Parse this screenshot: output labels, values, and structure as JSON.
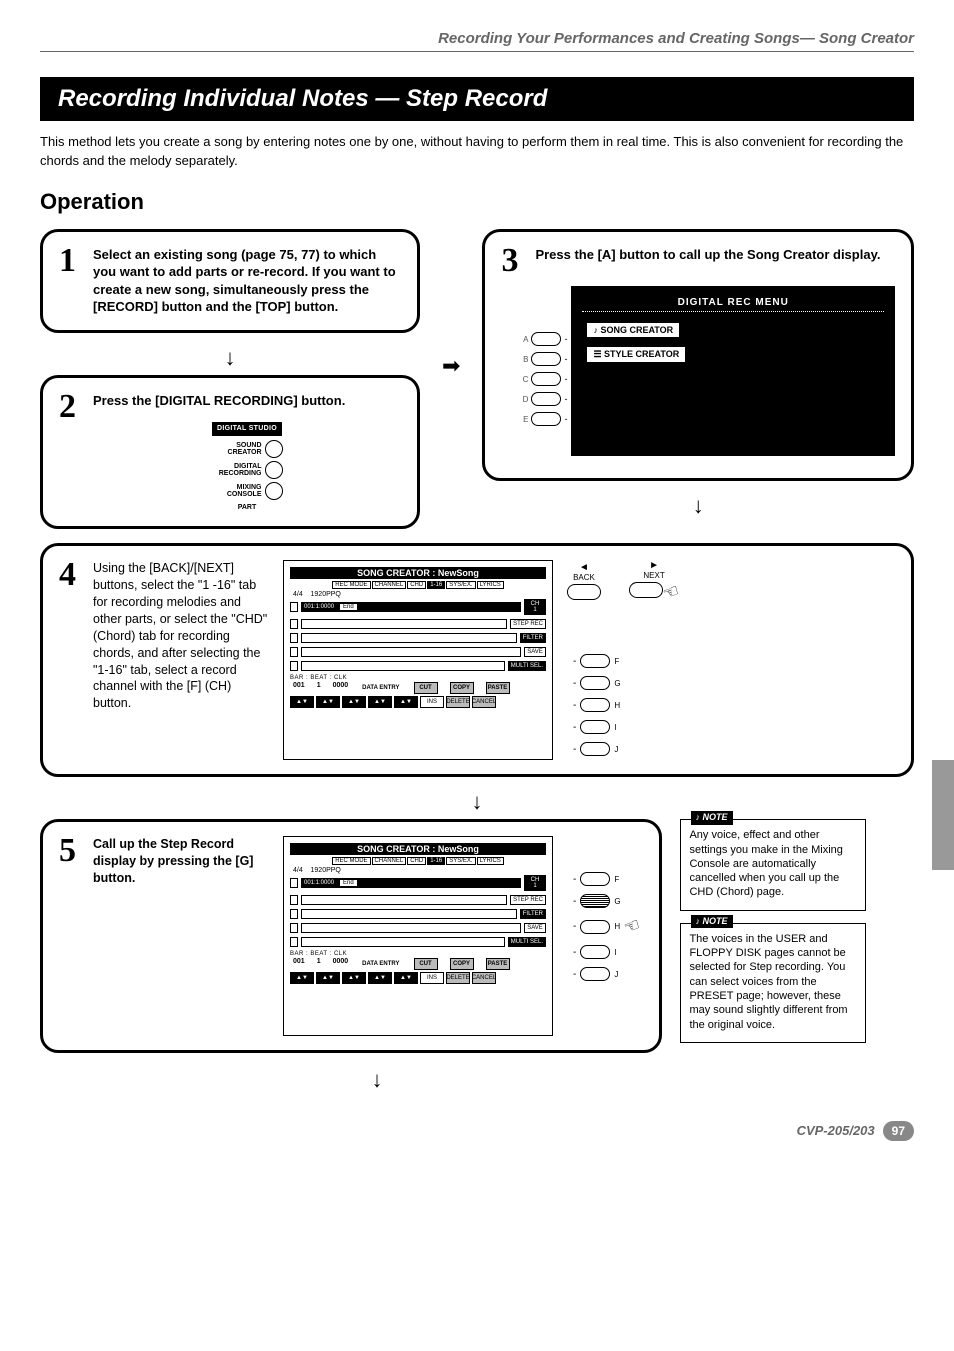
{
  "header": {
    "breadcrumb": "Recording Your Performances and Creating Songs— Song Creator"
  },
  "section": {
    "title": "Recording Individual Notes — Step Record"
  },
  "intro": "This method lets you create a song by entering notes one by one, without having to perform them in real time. This is also convenient for recording the chords and the melody separately.",
  "operation_heading": "Operation",
  "steps": {
    "s1": {
      "num": "1",
      "text": "Select an existing song (page 75, 77) to which you want to add parts or re-record. If you want to create a new song, simultaneously press the [RECORD] button and the [TOP] button."
    },
    "s2": {
      "num": "2",
      "text": "Press the [DIGITAL RECORDING] button.",
      "panel": {
        "group": "DIGITAL STUDIO",
        "btn1": "SOUND CREATOR",
        "btn2": "DIGITAL RECORDING",
        "btn3": "MIXING CONSOLE",
        "part": "PART"
      }
    },
    "s3": {
      "num": "3",
      "text": "Press the [A] button to call up the Song Creator display.",
      "lcd_title": "DIGITAL REC MENU",
      "opts": {
        "a": "SONG CREATOR",
        "b": "STYLE CREATOR"
      },
      "letters": [
        "A",
        "B",
        "C",
        "D",
        "E"
      ]
    },
    "s4": {
      "num": "4",
      "text": "Using the [BACK]/[NEXT] buttons, select the \"1 -16\" tab for recording melodies and other parts, or select the \"CHD\" (Chord) tab for recording chords, and after selecting the \"1-16\" tab, select a record channel with the [F] (CH) button.",
      "back": "BACK",
      "next": "NEXT"
    },
    "s5": {
      "num": "5",
      "text": "Call up the Step Record display by pressing the [G] button."
    }
  },
  "screen": {
    "title": "SONG CREATOR : NewSong",
    "tabs": [
      "REC MODE",
      "CHANNEL",
      "CHD",
      "1-16",
      "SYS/EX.",
      "LYRICS"
    ],
    "meta_left": "4/4",
    "meta_right": "1920PPQ",
    "row1_left": "001:1:0000",
    "row1_end": "End",
    "side_labels": [
      "CH",
      "STEP REC",
      "FILTER",
      "SAVE",
      "MULTI SEL."
    ],
    "ch_value": "1",
    "bbc_label": "BAR  :  BEAT  :  CLK",
    "bar": "001",
    "beat": "1",
    "clk": "0000",
    "data_entry": "DATA ENTRY",
    "bottom_btns": [
      "CUT",
      "COPY",
      "PASTE",
      "INS",
      "DELETE",
      "CANCEL"
    ],
    "right_letters": [
      "F",
      "G",
      "H",
      "I",
      "J"
    ]
  },
  "notes": {
    "tag": "NOTE",
    "n1": "Any voice, effect and other settings you make in the Mixing Console are automatically cancelled when you call up the CHD (Chord) page.",
    "n2": "The voices in the USER and FLOPPY DISK pages cannot be selected for Step recording. You can select voices from the PRESET page; however, these may sound slightly different from the original voice."
  },
  "footer": {
    "model": "CVP-205/203",
    "page": "97"
  }
}
